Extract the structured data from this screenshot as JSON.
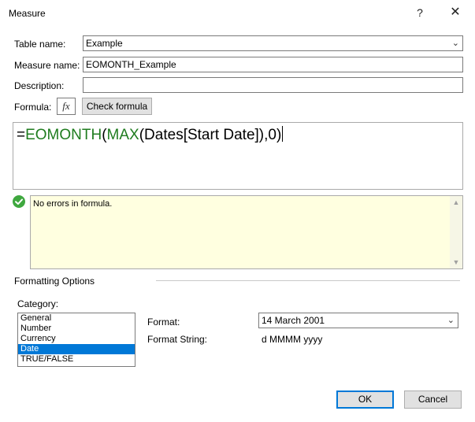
{
  "window": {
    "title": "Measure",
    "help_glyph": "?",
    "close_glyph": "✕"
  },
  "form": {
    "table_name": {
      "label": "Table name:",
      "value": "Example"
    },
    "measure_name": {
      "label": "Measure name:",
      "value": "EOMONTH_Example"
    },
    "description": {
      "label": "Description:",
      "value": ""
    },
    "formula": {
      "label": "Formula:",
      "fx_glyph": "fx",
      "check_button": "Check formula"
    }
  },
  "formula_editor": {
    "eq": "=",
    "fn1": "EOMONTH",
    "paren1": "(",
    "fn2": "MAX",
    "rest": "(Dates[Start Date]),0)",
    "function_color": "#1f7c1f"
  },
  "validation": {
    "status_icon": "check-circle-icon",
    "message": "No errors in formula."
  },
  "formatting": {
    "section_label": "Formatting Options",
    "category_label": "Category:",
    "categories": [
      "General",
      "Number",
      "Currency",
      "Date",
      "TRUE/FALSE"
    ],
    "selected_category": "Date",
    "format_label": "Format:",
    "format_value": "14 March 2001",
    "format_string_label": "Format String:",
    "format_string_value": "d MMMM yyyy"
  },
  "buttons": {
    "ok": "OK",
    "cancel": "Cancel"
  },
  "colors": {
    "accent": "#0078d7",
    "message_bg": "#ffffe0",
    "success": "#3fa83f"
  }
}
